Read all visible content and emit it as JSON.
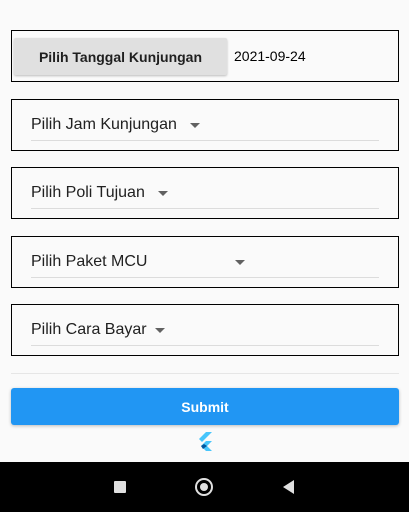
{
  "form": {
    "date_button_label": "Pilih Tanggal Kunjungan",
    "date_value": "2021-09-24",
    "dropdowns": [
      {
        "label": "Pilih Jam Kunjungan"
      },
      {
        "label": "Pilih Poli Tujuan"
      },
      {
        "label": "Pilih Paket MCU"
      },
      {
        "label": "Pilih Cara Bayar"
      }
    ],
    "submit_label": "Submit"
  },
  "colors": {
    "accent": "#2196f3",
    "flutter_light": "#47c5fb",
    "flutter_dark": "#00569e"
  },
  "icons": {
    "dropdown": "arrow-drop-down-icon",
    "logo": "flutter-logo-icon",
    "nav": [
      "recents-square-icon",
      "home-circle-icon",
      "back-triangle-icon"
    ]
  }
}
